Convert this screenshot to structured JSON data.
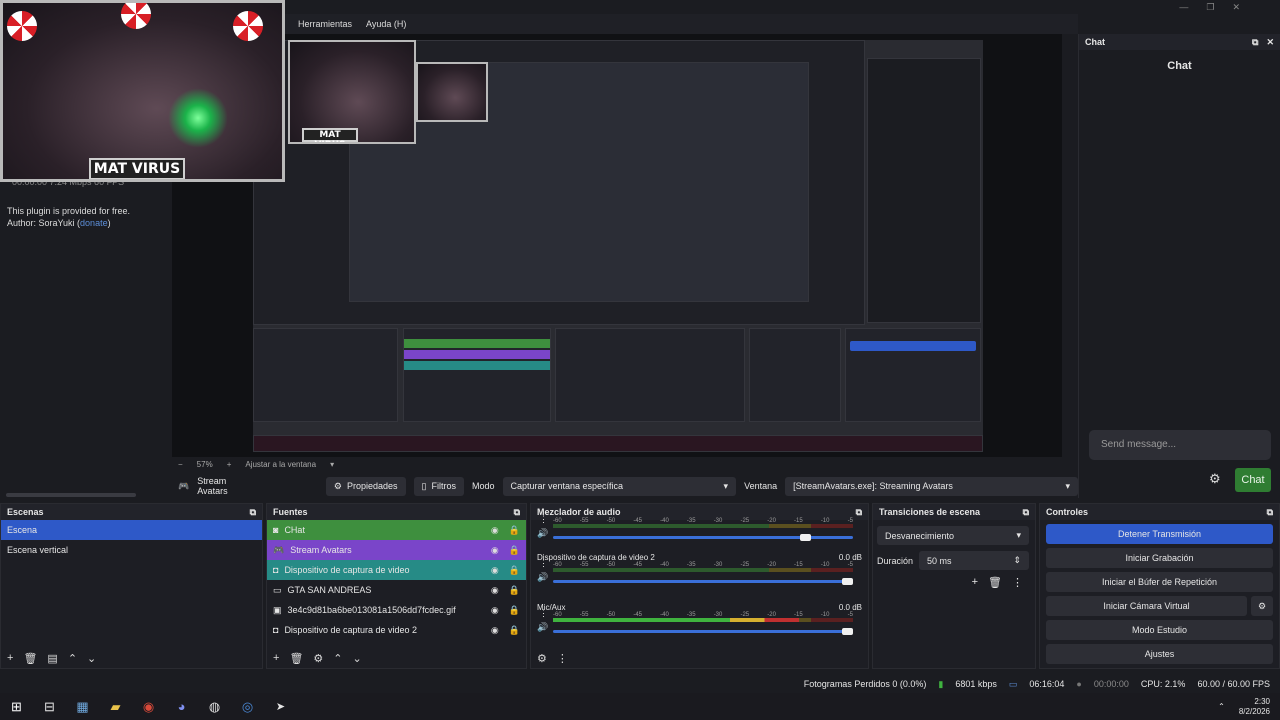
{
  "menu": {
    "items": [
      "Herramientas",
      "Ayuda (H)"
    ]
  },
  "plugin": {
    "line1": "This plugin is provided for free.",
    "line2_prefix": "Author: SoraYuki (",
    "line2_link": "donate",
    "line2_suffix": ")",
    "ghost": "00:00:00 7.24 Mbps 60 FPS"
  },
  "overlay": {
    "name": "MAT VIRUS"
  },
  "preview": {
    "zoom": "57%",
    "fit": "Ajustar a la ventana"
  },
  "source_toolbar": {
    "source": "Stream Avatars",
    "properties": "Propiedades",
    "filters": "Filtros",
    "mode_label": "Modo",
    "mode_value": "Capturar ventana específica",
    "window_label": "Ventana",
    "window_value": "[StreamAvatars.exe]: Streaming Avatars"
  },
  "chat": {
    "dock_title": "Chat",
    "title": "Chat",
    "placeholder": "Send message...",
    "send": "Chat"
  },
  "scenes": {
    "title": "Escenas",
    "items": [
      "Escena",
      "Escena vertical"
    ],
    "selected": 0
  },
  "sources": {
    "title": "Fuentes",
    "items": [
      {
        "name": "CHat",
        "icon": "chat-icon",
        "color": "#3e8f3e"
      },
      {
        "name": "Stream Avatars",
        "icon": "gamepad-icon",
        "color": "#7a45c9"
      },
      {
        "name": "Dispositivo de captura de video",
        "icon": "camera-icon",
        "color": "#268b86"
      },
      {
        "name": "GTA SAN ANDREAS",
        "icon": "monitor-icon",
        "color": ""
      },
      {
        "name": "3e4c9d81ba6be013081a1506dd7fcdec.gif",
        "icon": "image-icon",
        "color": ""
      },
      {
        "name": "Dispositivo de captura de video 2",
        "icon": "camera-icon",
        "color": ""
      }
    ]
  },
  "mixer": {
    "title": "Mezclador de audio",
    "ticks": [
      "-60",
      "-55",
      "-50",
      "-45",
      "-40",
      "-35",
      "-30",
      "-25",
      "-20",
      "-15",
      "-10",
      "-5"
    ],
    "tracks": [
      {
        "name": "",
        "db": "",
        "level": 0.0,
        "volume": 0.86
      },
      {
        "name": "Dispositivo de captura de video 2",
        "db": "0.0 dB",
        "level": 0.0,
        "volume": 1.0
      },
      {
        "name": "Mic/Aux",
        "db": "0.0 dB",
        "level": 0.82,
        "volume": 1.0
      }
    ]
  },
  "transitions": {
    "title": "Transiciones de escena",
    "type": "Desvanecimiento",
    "duration_label": "Duración",
    "duration_value": "50 ms"
  },
  "controls": {
    "title": "Controles",
    "buttons": [
      "Detener Transmisión",
      "Iniciar Grabación",
      "Iniciar el Búfer de Repetición",
      "Iniciar Cámara Virtual",
      "Modo Estudio",
      "Ajustes"
    ]
  },
  "status": {
    "dropped": "Fotogramas Perdidos 0 (0.0%)",
    "bitrate": "6801 kbps",
    "live": "06:16:04",
    "rec": "00:00:00",
    "cpu": "CPU: 2.1%",
    "fps": "60.00 / 60.00 FPS"
  },
  "taskbar": {
    "time": "2:30",
    "date": "8/2/2026"
  },
  "colors": {
    "accent": "#2e59c8",
    "green": "#3e8f3e",
    "purple": "#7a45c9",
    "teal": "#268b86"
  }
}
